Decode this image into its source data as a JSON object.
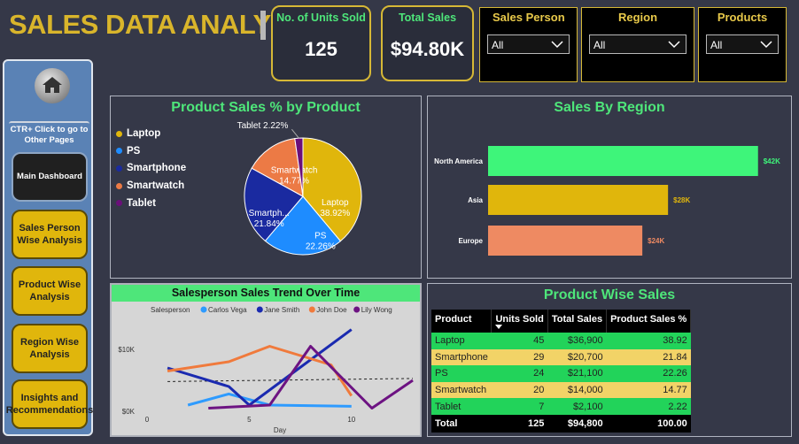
{
  "header": {
    "title": "SALES DATA ANALYSIS"
  },
  "kpis": [
    {
      "label": "No. of Units Sold",
      "value": "125"
    },
    {
      "label": "Total Sales",
      "value": "$94.80K"
    }
  ],
  "slicers": [
    {
      "label": "Sales Person",
      "value": "All"
    },
    {
      "label": "Region",
      "value": "All"
    },
    {
      "label": "Products",
      "value": "All"
    }
  ],
  "nav": {
    "note": "CTR+ Click to go to Other Pages",
    "buttons": [
      "Main Dashboard",
      "Sales Person Wise Analysis",
      "Product Wise Analysis",
      "Region Wise Analysis",
      "Insights and Recommendations"
    ]
  },
  "colors": {
    "accent_green": "#4ee67a",
    "gold": "#d9b52b",
    "background": "#353848"
  },
  "chart_data": [
    {
      "type": "pie",
      "title": "Product Sales % by Product",
      "categories": [
        "Laptop",
        "PS",
        "Smartphone",
        "Smartwatch",
        "Tablet"
      ],
      "values": [
        38.92,
        22.26,
        21.84,
        14.77,
        2.22
      ],
      "slice_labels": [
        "Laptop\n38.92%",
        "PS\n22.26%",
        "Smartph...\n21.84%",
        "Smartwatch\n14.77%",
        "Tablet 2.22%"
      ],
      "colors": [
        "#e0b60c",
        "#1e8cff",
        "#1a2aa0",
        "#ec7a45",
        "#6b0f7a"
      ],
      "legend": "left"
    },
    {
      "type": "bar",
      "orientation": "horizontal",
      "title": "Sales By Region",
      "categories": [
        "North America",
        "Asia",
        "Europe"
      ],
      "values": [
        42,
        28,
        24
      ],
      "value_labels": [
        "$42K",
        "$28K",
        "$24K"
      ],
      "colors": [
        "#3ef57a",
        "#e0b60c",
        "#ee8a62"
      ],
      "xlim": [
        0,
        43
      ]
    },
    {
      "type": "line",
      "title": "Salesperson Sales Trend Over Time",
      "legend_title": "Salesperson",
      "xlabel": "Day",
      "x_ticks": [
        0,
        5,
        10
      ],
      "y_ticks": [
        "$0K",
        "$10K"
      ],
      "xlim": [
        0,
        13
      ],
      "ylim": [
        0,
        14
      ],
      "series": [
        {
          "name": "Carlos Vega",
          "color": "#2e9bff",
          "x": [
            2,
            4,
            6,
            10
          ],
          "y": [
            1,
            2.8,
            1,
            0.8
          ]
        },
        {
          "name": "Jane Smith",
          "color": "#1a2ab0",
          "x": [
            1,
            4,
            5,
            10
          ],
          "y": [
            7,
            4,
            1,
            13.2
          ]
        },
        {
          "name": "John Doe",
          "color": "#f07a3c",
          "x": [
            1,
            4,
            6,
            9,
            10
          ],
          "y": [
            6.5,
            8,
            10.5,
            7.5,
            2.5
          ]
        },
        {
          "name": "Lily Wong",
          "color": "#6d1382",
          "x": [
            3,
            6,
            8,
            11,
            13
          ],
          "y": [
            0.5,
            1,
            10.5,
            0.5,
            5
          ]
        }
      ],
      "trendline": {
        "x": [
          1,
          13
        ],
        "y": [
          4.8,
          5.3
        ]
      }
    },
    {
      "type": "table",
      "title": "Product Wise Sales",
      "columns": [
        "Product",
        "Units Sold",
        "Total Sales",
        "Product Sales %"
      ],
      "rows": [
        [
          "Laptop",
          "45",
          "$36,900",
          "38.92"
        ],
        [
          "Smartphone",
          "29",
          "$20,700",
          "21.84"
        ],
        [
          "PS",
          "24",
          "$21,100",
          "22.26"
        ],
        [
          "Smartwatch",
          "20",
          "$14,000",
          "14.77"
        ],
        [
          "Tablet",
          "7",
          "$2,100",
          "2.22"
        ]
      ],
      "total": [
        "Total",
        "125",
        "$94,800",
        "100.00"
      ]
    }
  ]
}
